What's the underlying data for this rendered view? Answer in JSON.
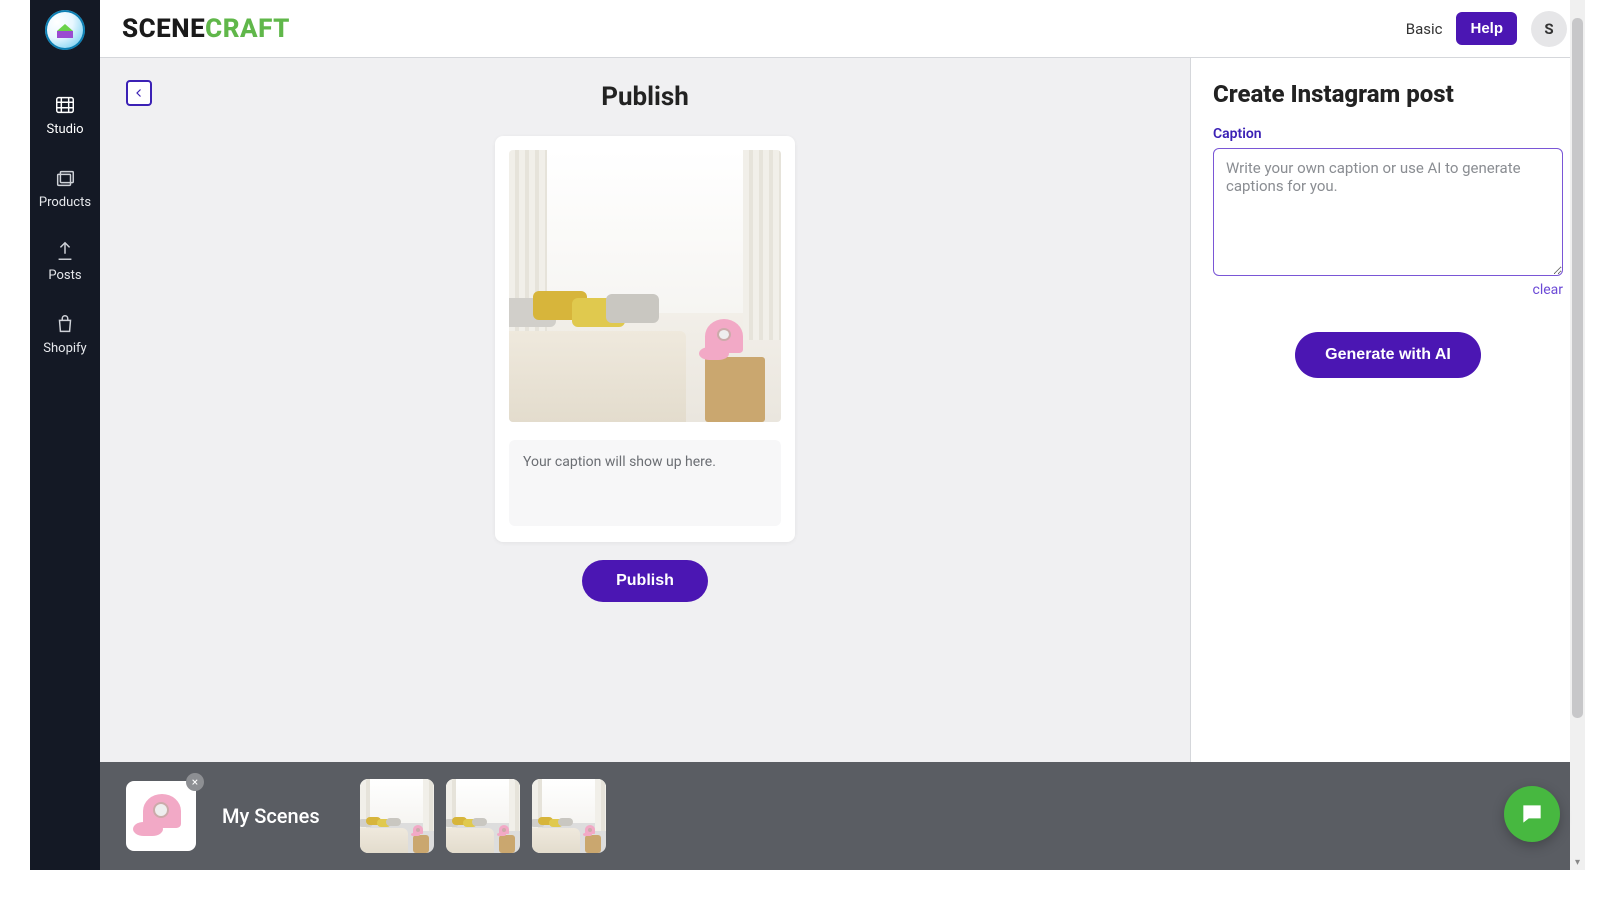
{
  "brand": {
    "part_a": "SCENE",
    "part_b": "CRAFT"
  },
  "header": {
    "plan_label": "Basic",
    "help_label": "Help",
    "avatar_initial": "S"
  },
  "sidebar": {
    "items": [
      {
        "id": "studio",
        "label": "Studio",
        "icon": "film-icon",
        "active": true
      },
      {
        "id": "products",
        "label": "Products",
        "icon": "layers-icon",
        "active": false
      },
      {
        "id": "posts",
        "label": "Posts",
        "icon": "upload-icon",
        "active": false
      },
      {
        "id": "shopify",
        "label": "Shopify",
        "icon": "bag-icon",
        "active": false
      }
    ]
  },
  "canvas": {
    "title": "Publish",
    "caption_preview_placeholder": "Your caption will show up here.",
    "publish_button": "Publish"
  },
  "right_panel": {
    "title": "Create Instagram post",
    "caption_label": "Caption",
    "caption_placeholder": "Write your own caption or use AI to generate captions for you.",
    "clear_label": "clear",
    "generate_button": "Generate with AI"
  },
  "tray": {
    "title": "My Scenes",
    "product_chip_remove": "×",
    "thumb_count": 3
  },
  "colors": {
    "accent": "#4b16b3",
    "brand_green": "#60b74a"
  }
}
